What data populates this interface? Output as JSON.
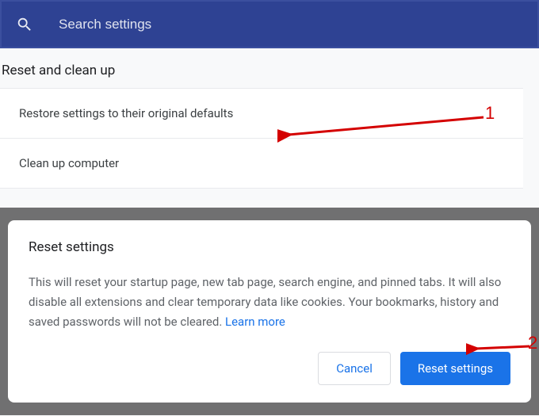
{
  "search": {
    "placeholder": "Search settings"
  },
  "section": {
    "title": "Reset and clean up",
    "rows": {
      "restore": "Restore settings to their original defaults",
      "cleanup": "Clean up computer"
    }
  },
  "dialog": {
    "title": "Reset settings",
    "body": "This will reset your startup page, new tab page, search engine, and pinned tabs. It will also disable all extensions and clear temporary data like cookies. Your bookmarks, history and saved passwords will not be cleared. ",
    "learn": "Learn more",
    "cancel": "Cancel",
    "confirm": "Reset settings"
  },
  "annotations": {
    "one": "1",
    "two": "2"
  }
}
